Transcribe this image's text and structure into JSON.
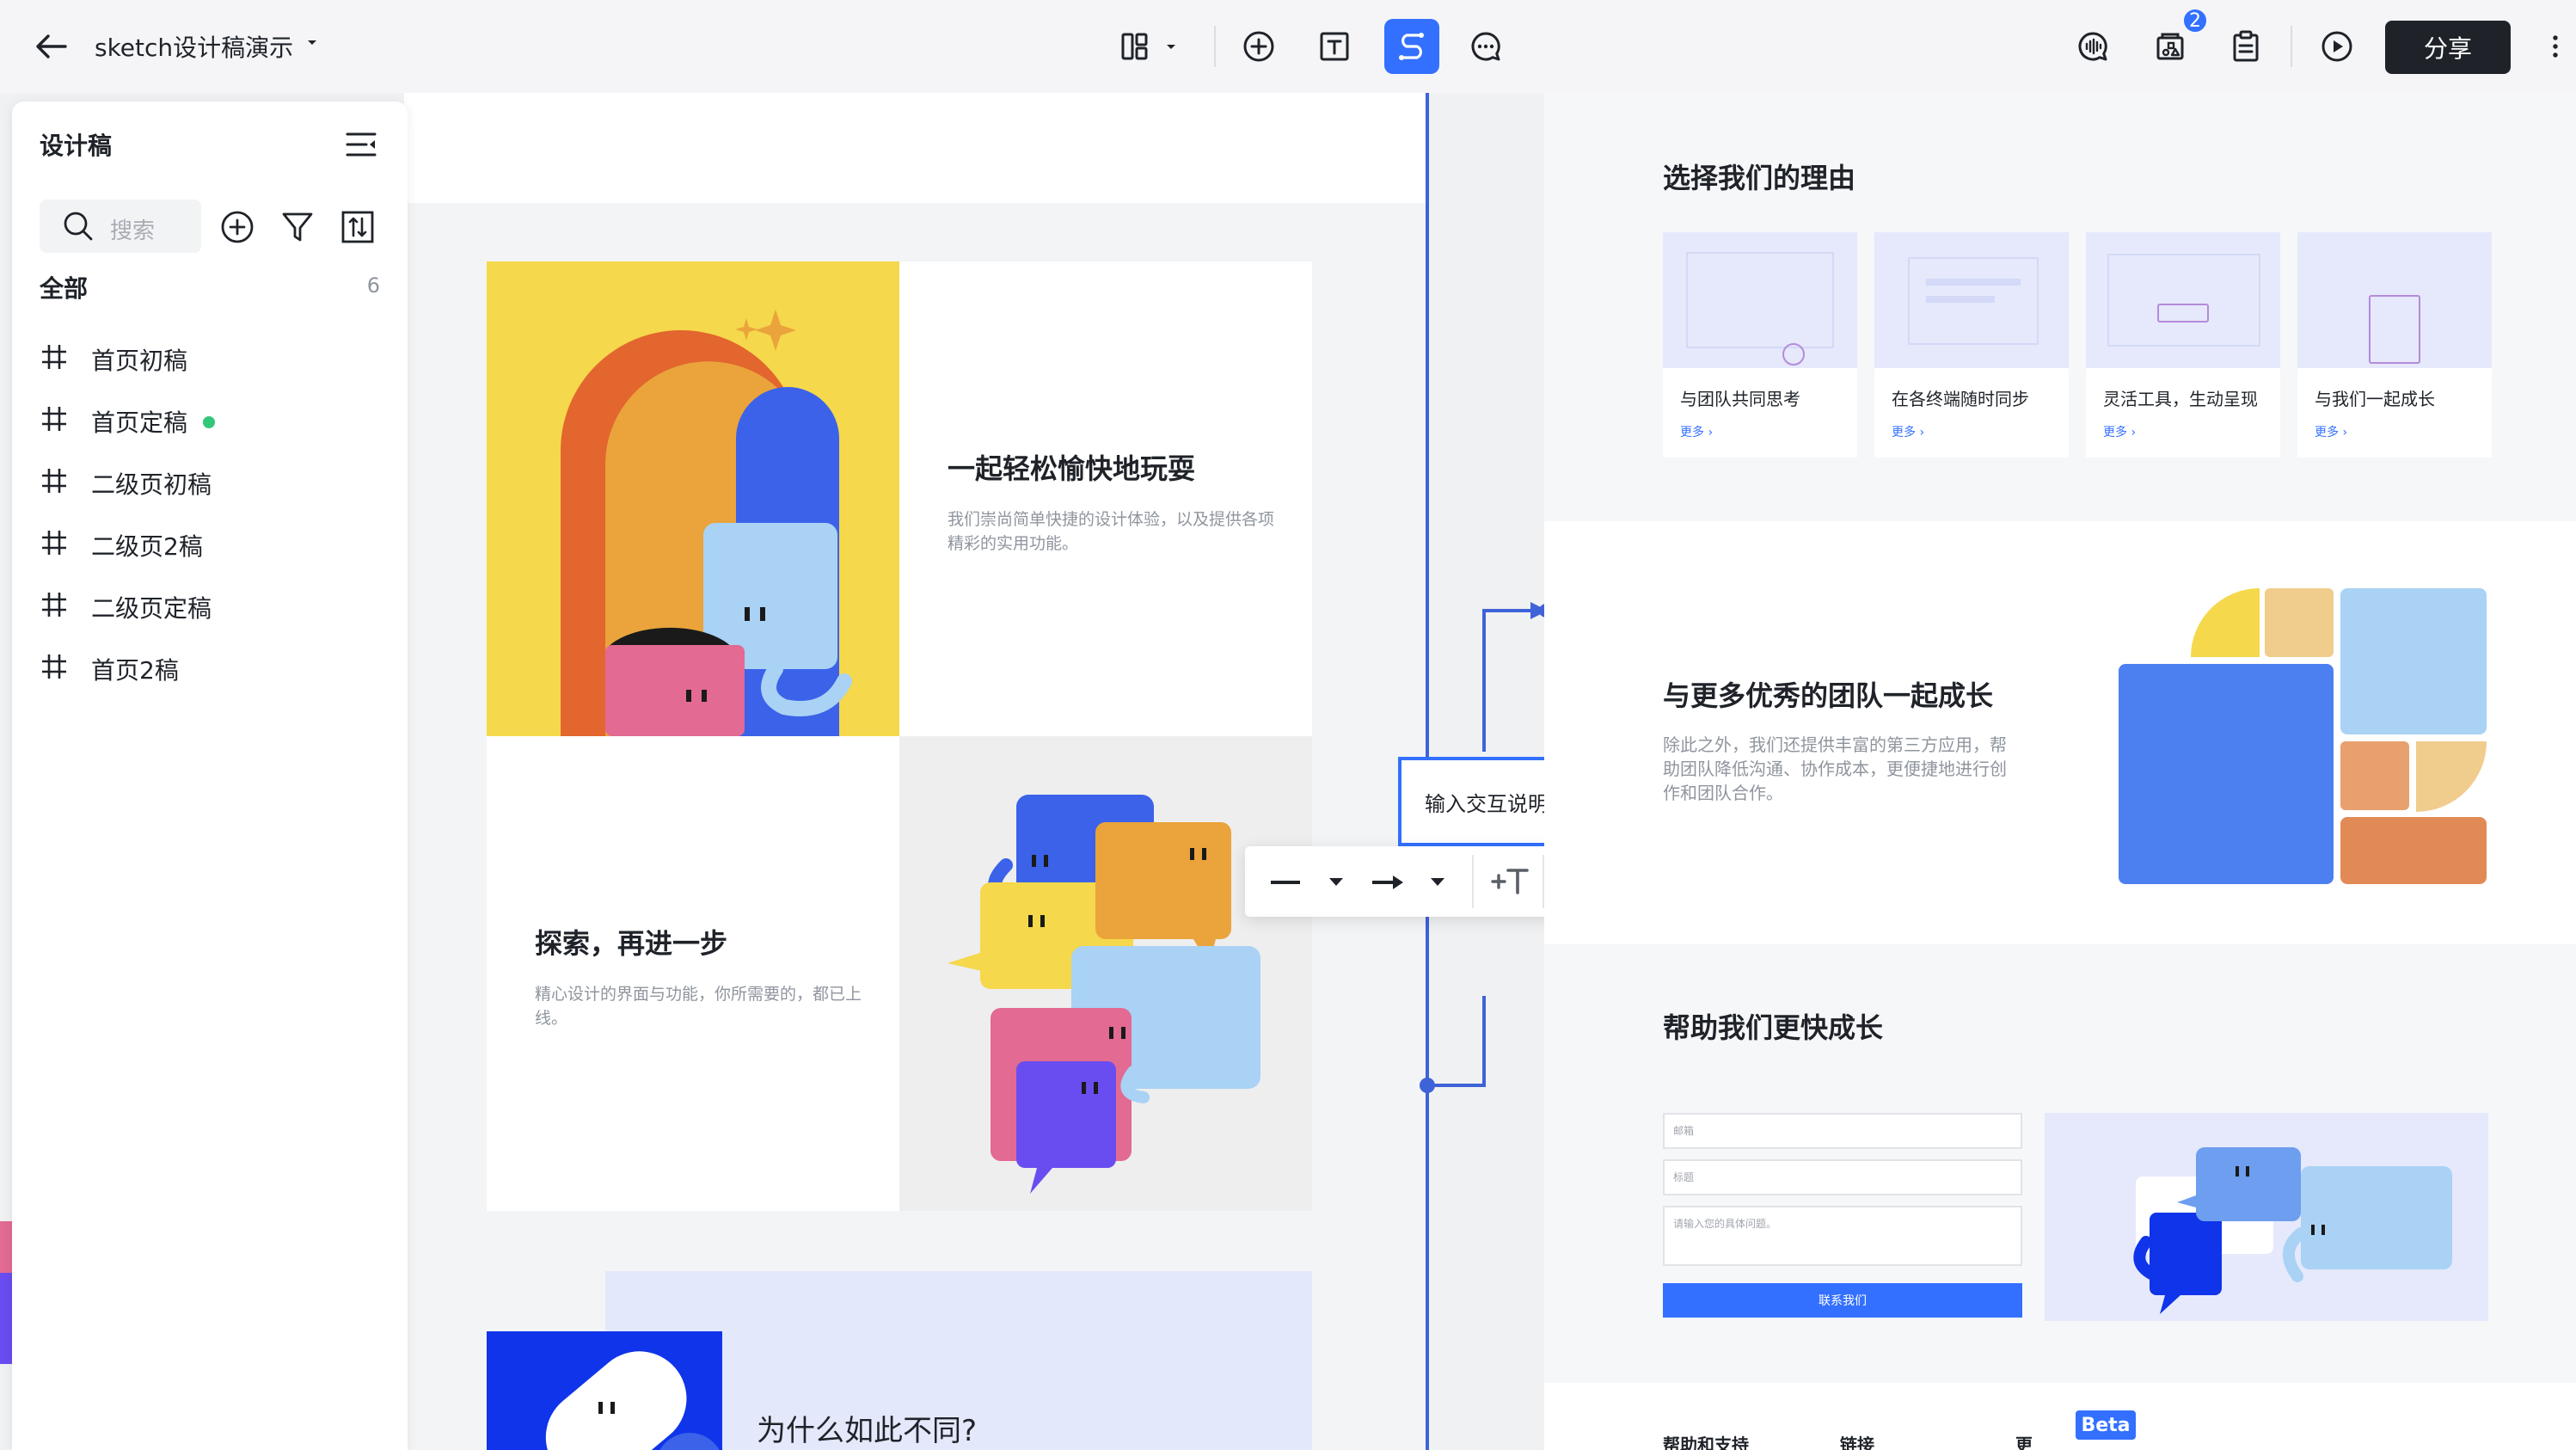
{
  "toolbar": {
    "title": "sketch设计稿演示",
    "share_label": "分享",
    "badge_count": "2",
    "icons": [
      "back-arrow-icon",
      "layout-icon",
      "add-circle-icon",
      "text-tool-icon",
      "connector-icon",
      "comment-icon",
      "voice-icon",
      "resources-icon",
      "clipboard-icon",
      "play-icon",
      "more-icon"
    ]
  },
  "sidebar": {
    "title": "设计稿",
    "search_placeholder": "搜索",
    "all_label": "全部",
    "all_count": "6",
    "items": [
      {
        "label": "首页初稿",
        "status": ""
      },
      {
        "label": "首页定稿",
        "status": "active"
      },
      {
        "label": "二级页初稿",
        "status": ""
      },
      {
        "label": "二级页2稿",
        "status": ""
      },
      {
        "label": "二级页定稿",
        "status": ""
      },
      {
        "label": "首页2稿",
        "status": ""
      }
    ]
  },
  "canvas": {
    "left_frame": {
      "block1_title": "一起轻松愉快地玩耍",
      "block1_text": "我们崇尚简单快捷的设计体验，以及提供各项精彩的实用功能。",
      "block2_title": "探索，再进一步",
      "block2_text": "精心设计的界面与功能，你所需要的，都已上线。",
      "block3_title": "为什么如此不同?"
    },
    "note_text": "输入交互说明",
    "right_frame": {
      "reasons_title": "选择我们的理由",
      "cards": [
        {
          "title": "与团队共同思考",
          "more": "更多 ›"
        },
        {
          "title": "在各终端随时同步",
          "more": "更多 ›"
        },
        {
          "title": "灵活工具，生动呈现",
          "more": "更多 ›"
        },
        {
          "title": "与我们一起成长",
          "more": "更多 ›"
        }
      ],
      "grow_title": "与更多优秀的团队一起成长",
      "grow_text": "除此之外，我们还提供丰富的第三方应用，帮助团队降低沟通、协作成本，更便捷地进行创作和团队合作。",
      "help_title": "帮助我们更快成长",
      "form": {
        "email_placeholder": "邮箱",
        "subject_placeholder": "标题",
        "message_placeholder": "请输入您的具体问题。",
        "submit_label": "联系我们"
      },
      "footer": [
        "帮助和支持",
        "链接",
        "更"
      ],
      "beta_label": "Beta"
    }
  },
  "colors": {
    "accent": "#3370ff",
    "connector": "#3e63d8",
    "yellow": "#f5d84b",
    "deep_blue": "#0f34ea"
  }
}
